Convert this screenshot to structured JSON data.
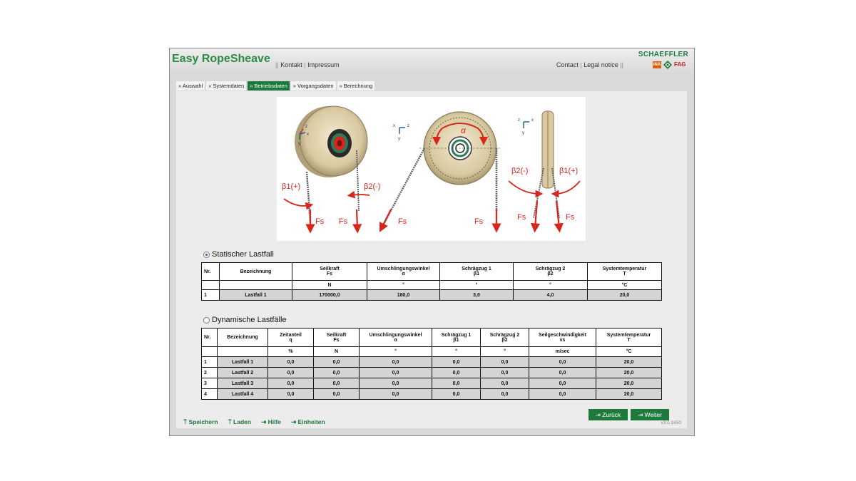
{
  "header": {
    "title": "Easy RopeSheave",
    "left_links": {
      "contact": "Kontakt",
      "imprint": "Impressum"
    },
    "right_links": {
      "contact": "Contact",
      "legal": "Legal notice"
    },
    "brand": "SCHAEFFLER",
    "logos": {
      "ina": "INA",
      "fag": "FAG"
    }
  },
  "tabs": [
    {
      "label": "» Auswahl",
      "active": false
    },
    {
      "label": "» Systemdaten",
      "active": false
    },
    {
      "label": "» Betriebsdaten",
      "active": true
    },
    {
      "label": "» Vorgangsdaten",
      "active": false
    },
    {
      "label": "» Berechnung",
      "active": false
    }
  ],
  "diagram": {
    "axis_labels": {
      "x": "x",
      "y": "y",
      "z": "z"
    },
    "labels": {
      "beta1": "β1(+)",
      "beta2": "β2(-)",
      "fs": "Fs",
      "alpha": "α"
    }
  },
  "static_section": {
    "label": "Statischer Lastfall",
    "selected": true,
    "headers": [
      "Nr.",
      "Bezeichnung",
      "Seilkraft\nFs",
      "Umschlingungswinkel\nα",
      "Schrägzug 1\nβ1",
      "Schrägzug 2\nβ2",
      "Systemtemperatur\nT"
    ],
    "units": [
      "",
      "",
      "N",
      "°",
      "°",
      "°",
      "°C"
    ],
    "rows": [
      [
        "1",
        "Lastfall 1",
        "170000,0",
        "180,0",
        "3,0",
        "4,0",
        "20,0"
      ]
    ]
  },
  "dynamic_section": {
    "label": "Dynamische Lastfälle",
    "selected": false,
    "headers": [
      "Nr.",
      "Bezeichnung",
      "Zeitanteil\nq",
      "Seilkraft\nFs",
      "Umschlingungswinkel\nα",
      "Schrägzug 1\nβ1",
      "Schrägzug 2\nβ2",
      "Seilgeschwindigkeit\nvs",
      "Systemtemperatur\nT"
    ],
    "units": [
      "",
      "",
      "%",
      "N",
      "°",
      "°",
      "°",
      "m/sec",
      "°C"
    ],
    "rows": [
      [
        "1",
        "Lastfall 1",
        "0,0",
        "0,0",
        "0,0",
        "0,0",
        "0,0",
        "0,0",
        "20,0"
      ],
      [
        "2",
        "Lastfall 2",
        "0,0",
        "0,0",
        "0,0",
        "0,0",
        "0,0",
        "0,0",
        "20,0"
      ],
      [
        "3",
        "Lastfall 3",
        "0,0",
        "0,0",
        "0,0",
        "0,0",
        "0,0",
        "0,0",
        "20,0"
      ],
      [
        "4",
        "Lastfall 4",
        "0,0",
        "0,0",
        "0,0",
        "0,0",
        "0,0",
        "0,0",
        "20,0"
      ]
    ]
  },
  "actions": {
    "save": "Speichern",
    "load": "Laden",
    "help": "Hilfe",
    "units": "Einheiten"
  },
  "nav": {
    "back": "Zurück",
    "next": "Weiter"
  },
  "version": "v3.0.1650",
  "colors": {
    "brand_green": "#1e7a3c",
    "title_green": "#2d8a45",
    "arrow_red": "#d7261e"
  }
}
